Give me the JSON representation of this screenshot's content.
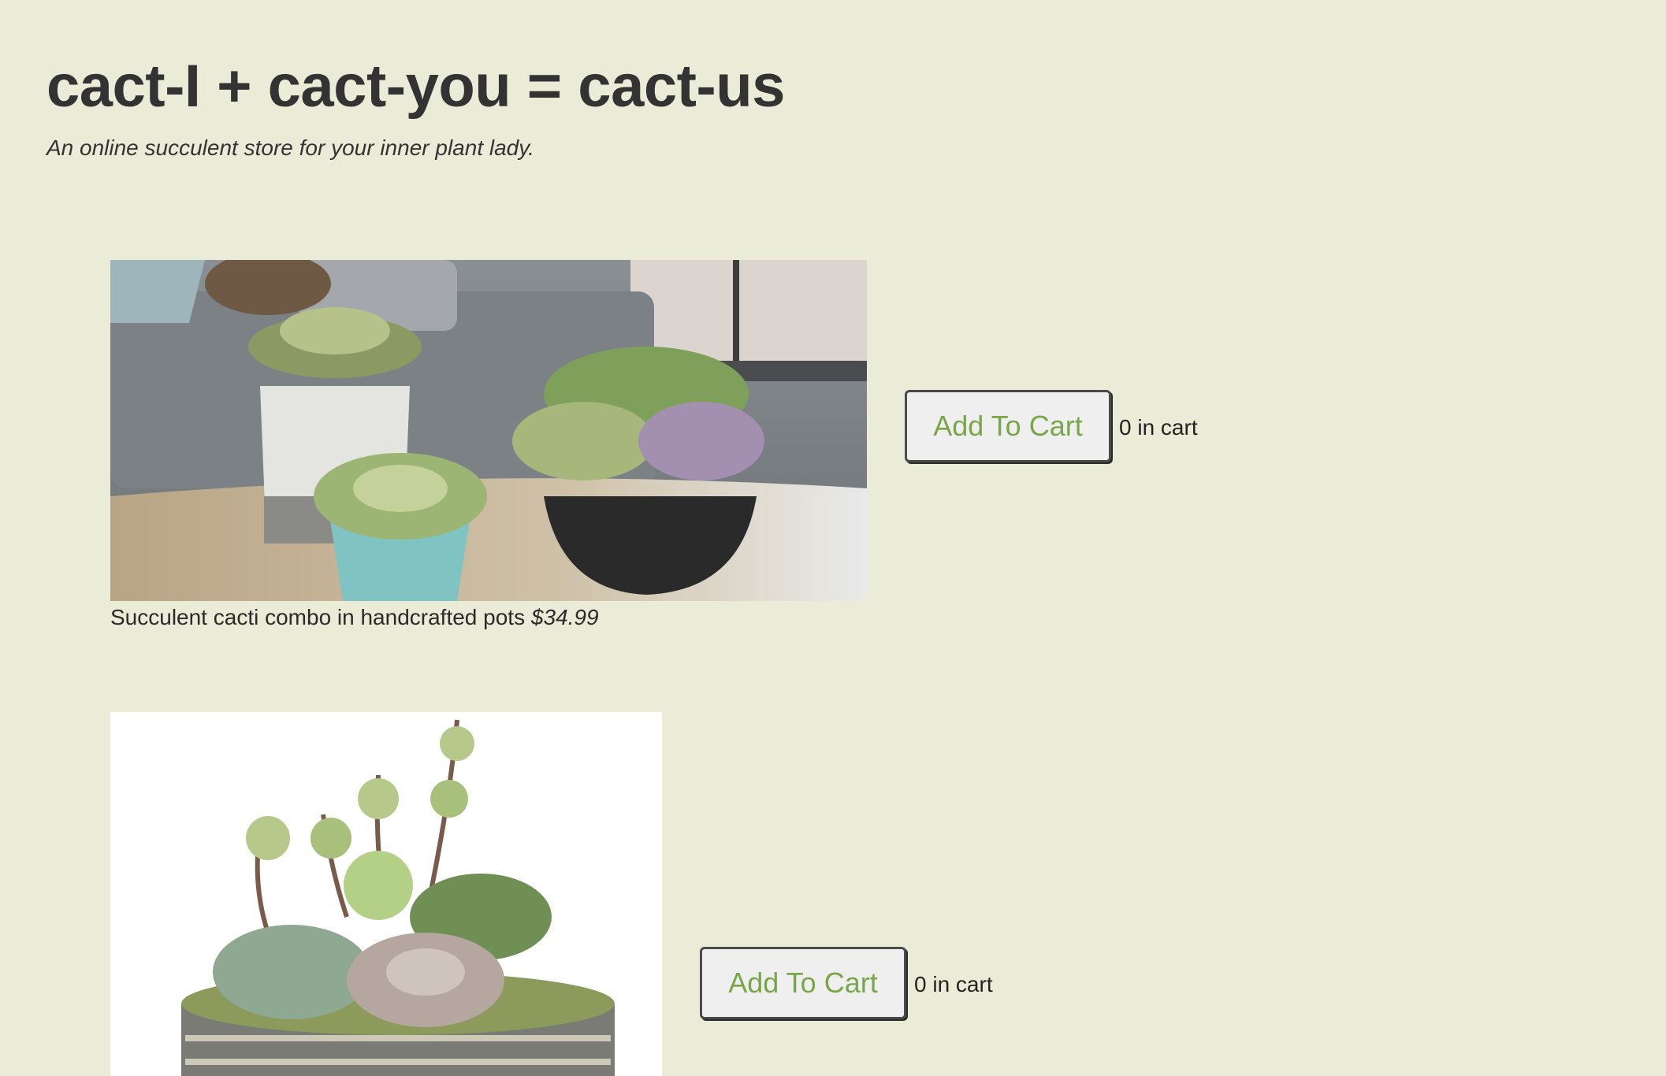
{
  "header": {
    "title": "cact-I + cact-you = cact-us",
    "tagline": "An online succulent store for your inner plant lady."
  },
  "products": [
    {
      "name": "Succulent cacti combo in handcrafted pots",
      "price": "$34.99",
      "button_label": "Add To Cart",
      "cart_count_label": "0 in cart",
      "cart_count": 0
    },
    {
      "button_label": "Add To Cart",
      "cart_count_label": "0 in cart",
      "cart_count": 0
    }
  ],
  "colors": {
    "page_background": "#ebecd7",
    "button_text": "#7aa64a",
    "button_background": "#efefef"
  }
}
